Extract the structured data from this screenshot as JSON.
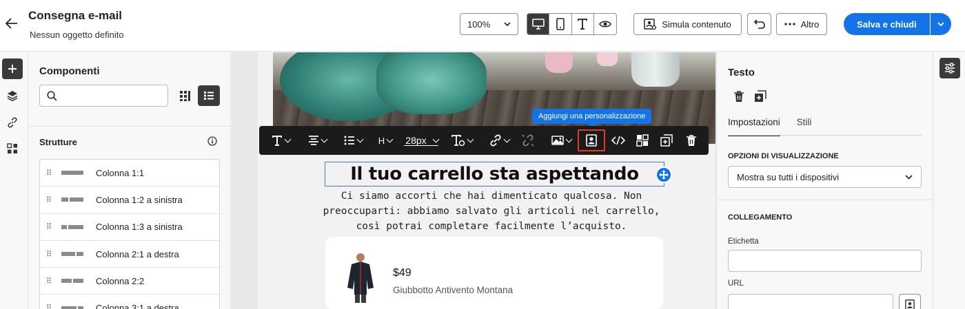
{
  "header": {
    "title": "Consegna e-mail",
    "subtitle": "Nessun oggetto definito",
    "zoom": "100%",
    "simulate_label": "Simula contenuto",
    "more_label": "Altro",
    "save_label": "Salva e chiudi",
    "accent_color": "#1473e6"
  },
  "components": {
    "title": "Componenti",
    "search_placeholder": "",
    "section_title": "Strutture",
    "structures": [
      {
        "label": "Colonna 1:1"
      },
      {
        "label": "Colonna 1:2 a sinistra"
      },
      {
        "label": "Colonna 1:3 a sinistra"
      },
      {
        "label": "Colonna 2:1 a destra"
      },
      {
        "label": "Colonna 2:2"
      },
      {
        "label": "Colonna 3:1 a destra"
      }
    ]
  },
  "toolbar": {
    "font_size": "28px",
    "heading_label": "H",
    "tooltip": "Aggiungi una personalizzazione"
  },
  "email": {
    "headline": "Il tuo carrello sta aspettando",
    "body": "Ci siamo accorti che hai dimenticato qualcosa. Non preoccuparti: abbiamo salvato gli articoli nel carrello, così potrai completare facilmente l’acquisto.",
    "product": {
      "price": "$49",
      "name": "Giubbotto Antivento Montana"
    }
  },
  "properties": {
    "title": "Testo",
    "tabs": [
      {
        "label": "Impostazioni",
        "active": true
      },
      {
        "label": "Stili",
        "active": false
      }
    ],
    "display_section": "OPZIONI DI VISUALIZZAZIONE",
    "display_value": "Mostra su tutti i dispositivi",
    "link_section": "COLLEGAMENTO",
    "label_field": "Etichetta",
    "label_value": "",
    "url_field": "URL",
    "url_value": ""
  }
}
